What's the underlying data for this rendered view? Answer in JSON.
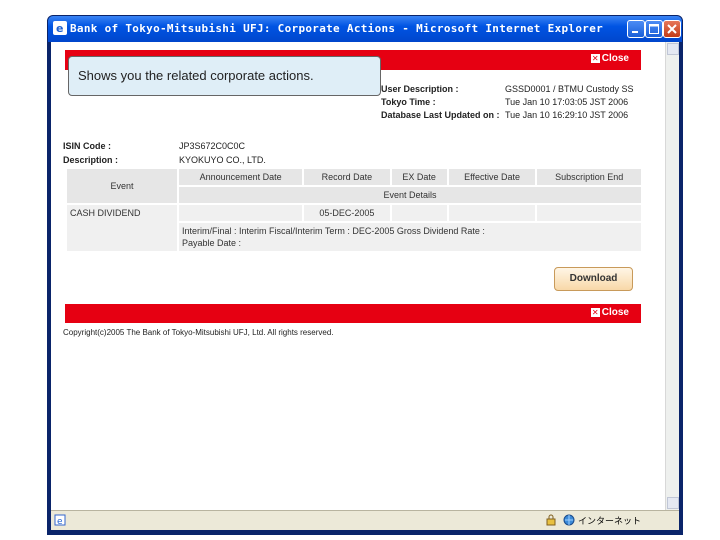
{
  "window": {
    "title": "Bank of Tokyo-Mitsubishi UFJ: Corporate Actions - Microsoft Internet Explorer"
  },
  "tooltip": "Shows you the related corporate actions.",
  "header": {
    "close_label": "Close",
    "user_description_label": "User Description :",
    "user_description_value": "GSSD0001 / BTMU Custody SS",
    "tokyo_time_label": "Tokyo Time :",
    "tokyo_time_value": "Tue Jan 10 17:03:05 JST 2006",
    "db_updated_label": "Database Last Updated on :",
    "db_updated_value": "Tue Jan 10 16:29:10 JST 2006"
  },
  "security": {
    "isin_label": "ISIN Code :",
    "isin_value": "JP3S672C0C0C",
    "description_label": "Description :",
    "description_value": "KYOKUYO CO., LTD."
  },
  "events_table": {
    "event_header": "Event",
    "columns": [
      "Announcement Date",
      "Record Date",
      "EX Date",
      "Effective Date",
      "Subscription End"
    ],
    "details_header": "Event Details",
    "rows": [
      {
        "event": "CASH DIVIDEND",
        "announcement_date": "",
        "record_date": "05-DEC-2005",
        "ex_date": "",
        "effective_date": "",
        "subscription_end": "",
        "details_line1": "Interim/Final : Interim Fiscal/Interim Term : DEC-2005 Gross Dividend Rate :",
        "details_line2": "Payable Date :"
      }
    ]
  },
  "download_label": "Download",
  "footer": {
    "close_label": "Close",
    "copyright": "Copyright(c)2005 The Bank of Tokyo-Mitsubishi UFJ, Ltd. All rights reserved."
  },
  "statusbar": {
    "zone": "インターネット"
  }
}
